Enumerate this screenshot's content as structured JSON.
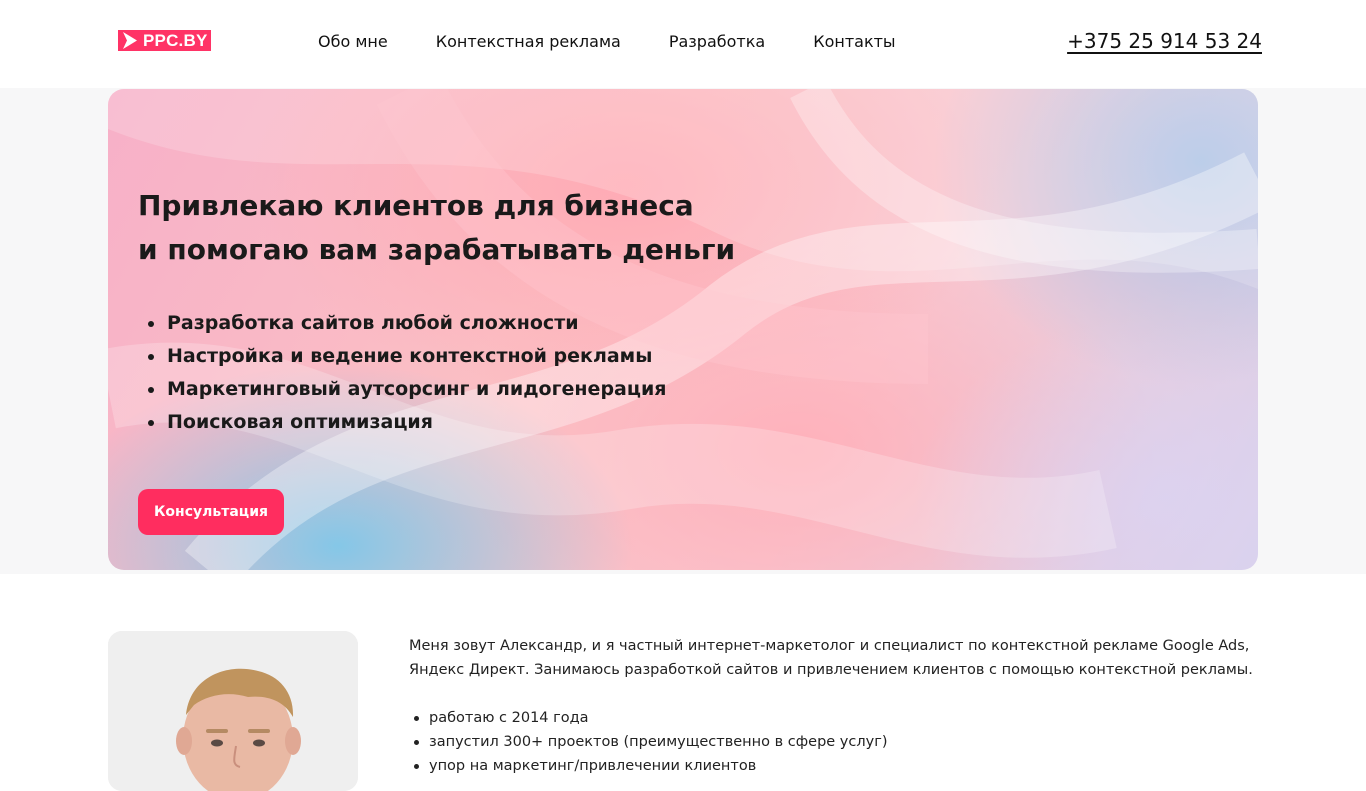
{
  "header": {
    "logo_text": "PPC.BY",
    "logo_icon": "play-triangle-icon",
    "nav": [
      {
        "label": "Обо мне"
      },
      {
        "label": "Контекстная реклама"
      },
      {
        "label": "Разработка"
      },
      {
        "label": "Контакты"
      }
    ],
    "phone": "+375 25 914 53 24"
  },
  "hero": {
    "title_line1": "Привлекаю клиентов для бизнеса",
    "title_line2": "и помогаю вам зарабатывать деньги",
    "services": [
      "Разработка сайтов любой сложности",
      "Настройка и ведение контекстной рекламы",
      "Маркетинговый аутсорсинг и лидогенерация",
      "Поисковая оптимизация"
    ],
    "cta_label": "Консультация"
  },
  "about": {
    "intro_line1": "Меня зовут Александр, и я частный интернет-маркетолог и специалист по контекстной рекламе Google Ads,",
    "intro_line2": "Яндекс Директ. Занимаюсь разработкой сайтов и привлечением клиентов с помощью контекстной рекламы.",
    "facts": [
      "работаю с 2014 года",
      "запустил 300+ проектов (преимущественно в сфере услуг)",
      "упор на маркетинг/привлечении клиентов"
    ]
  },
  "colors": {
    "accent": "#ff2d5f",
    "logo_bg": "#ff3366"
  }
}
